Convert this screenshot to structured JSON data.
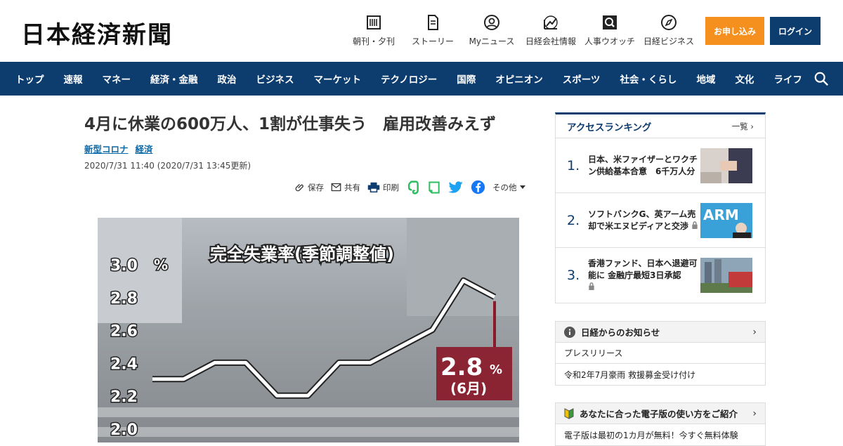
{
  "header": {
    "logo": "日本経済新聞",
    "nav": [
      {
        "label": "朝刊・夕刊",
        "icon": "newspaper-icon"
      },
      {
        "label": "ストーリー",
        "icon": "book-icon"
      },
      {
        "label": "Myニュース",
        "icon": "user-icon"
      },
      {
        "label": "日経会社情報",
        "icon": "stock-chart-icon"
      },
      {
        "label": "人事ウオッチ",
        "icon": "magnifier-icon"
      },
      {
        "label": "日経ビジネス",
        "icon": "compass-icon"
      }
    ],
    "subscribe": "お申し込み",
    "login": "ログイン"
  },
  "mainnav": [
    "トップ",
    "速報",
    "マネー",
    "経済・金融",
    "政治",
    "ビジネス",
    "マーケット",
    "テクノロジー",
    "国際",
    "オピニオン",
    "スポーツ",
    "社会・くらし",
    "地域",
    "文化",
    "ライフ"
  ],
  "article": {
    "title": "4月に休業の600万人、1割が仕事失う　雇用改善みえず",
    "tags": [
      "新型コロナ",
      "経済"
    ],
    "date": "2020/7/31 11:40 (2020/7/31 13:45更新)",
    "share": {
      "save": "保存",
      "mail": "共有",
      "print": "印刷",
      "more": "その他"
    }
  },
  "chart_data": {
    "type": "line",
    "title": "完全失業率(季節調整値)",
    "ylabel": "%",
    "ylim": [
      2.0,
      3.0
    ],
    "yticks": [
      "3.0",
      "2.8",
      "2.6",
      "2.4",
      "2.2",
      "2.0"
    ],
    "values": [
      2.3,
      2.3,
      2.4,
      2.4,
      2.2,
      2.2,
      2.4,
      2.4,
      2.5,
      2.6,
      2.9,
      2.8
    ],
    "annotation": {
      "value": "2.8",
      "unit": "%",
      "note": "(6月)"
    }
  },
  "sidebar": {
    "ranking_title": "アクセスランキング",
    "ranking_more": "一覧",
    "ranking": [
      {
        "n": "1.",
        "text": "日本、米ファイザーとワクチン供給基本合意　6千万人分",
        "locked": false
      },
      {
        "n": "2.",
        "text": "ソフトバンクG、英アーム売却で米エヌビディアと交渉",
        "locked": true,
        "thumb": "ARM"
      },
      {
        "n": "3.",
        "text": "香港ファンド、日本へ退避可能に 金融庁最短3日承認",
        "locked": true
      }
    ],
    "notice_title": "日経からのお知らせ",
    "notices": [
      "プレスリリース",
      "令和2年7月豪雨 救援募金受け付け"
    ],
    "guide_title": "あなたに合った電子版の使い方をご紹介",
    "guide_rows": [
      "電子版は最初の1カ月が無料！今すぐ無料体験"
    ]
  }
}
